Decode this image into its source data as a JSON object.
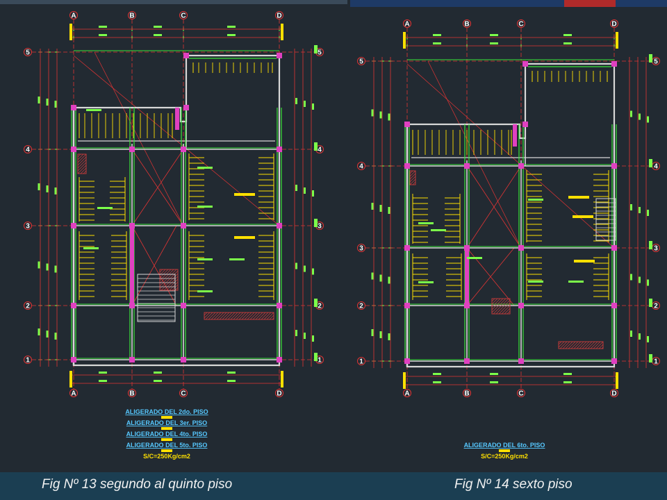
{
  "colors": {
    "background": "#222a32",
    "axis": "#e23434",
    "walls": "#d8d8d8",
    "beams": "#39e639",
    "columns": "#e040c0",
    "text_green": "#7cff4a",
    "text_yellow": "#ffe000",
    "text_cyan": "#56c8ff",
    "hatch": "#c03a3a"
  },
  "left_plan": {
    "top_axes": [
      "A",
      "B",
      "C",
      "D"
    ],
    "bottom_axes": [
      "A",
      "B",
      "C",
      "D"
    ],
    "row_axes": [
      "5",
      "4",
      "3",
      "2",
      "1"
    ],
    "legend": [
      "ALIGERADO DEL 2do. PISO",
      "ALIGERADO DEL 3er. PISO",
      "ALIGERADO DEL 4to. PISO",
      "ALIGERADO DEL 5to. PISO"
    ],
    "load": "S/C=250Kg/cm2"
  },
  "right_plan": {
    "top_axes": [
      "A",
      "B",
      "C",
      "D"
    ],
    "bottom_axes": [
      "A",
      "B",
      "C",
      "D"
    ],
    "row_axes": [
      "5",
      "4",
      "3",
      "2",
      "1"
    ],
    "legend": [
      "ALIGERADO DEL 6to. PISO"
    ],
    "load": "S/C=250Kg/cm2"
  },
  "captions": {
    "left": "Fig Nº 13 segundo al quinto piso",
    "right": "Fig Nº 14 sexto piso"
  }
}
